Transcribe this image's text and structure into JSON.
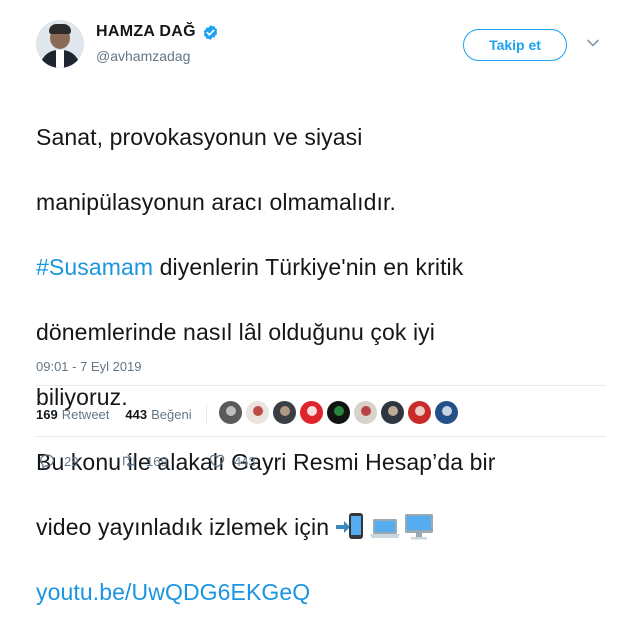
{
  "tweet": {
    "author_name": "HAMZA DAĞ",
    "author_handle": "@avhamzadag",
    "follow_label": "Takip et",
    "lines": [
      "Sanat, provokasyonun ve siyasi",
      "manipülasyonun aracı olmamalıdır."
    ],
    "hashtag": "#Susamam",
    "line3_rest": " diyenlerin Türkiye'nin en kritik",
    "line4": "dönemlerinde nasıl lâl olduğunu çok iyi",
    "line5": "biliyoruz.",
    "line6": "Bu konu ile alakalı Gayri Resmi Hesap’da bir",
    "line7": "video yayınladık izlemek için",
    "link": "youtu.be/UwQDG6EKGeQ",
    "timestamp": "09:01 - 7 Eyl 2019"
  },
  "stats": {
    "retweets": "169",
    "retweets_label": "Retweet",
    "likes": "443",
    "likes_label": "Beğeni"
  },
  "actions": {
    "replies": "29",
    "retweets": "169",
    "likes": "443"
  },
  "likers": [
    {
      "icon": "avatar-1",
      "bg": "#5a5a5a",
      "fg": "#d0d0d0"
    },
    {
      "icon": "avatar-2",
      "bg": "#e9e4e0",
      "fg": "#b5302a"
    },
    {
      "icon": "avatar-3",
      "bg": "#3a3f46",
      "fg": "#c9a98f"
    },
    {
      "icon": "avatar-4",
      "bg": "#e0242c",
      "fg": "#ffffff"
    },
    {
      "icon": "avatar-5",
      "bg": "#111511",
      "fg": "#2f9a48"
    },
    {
      "icon": "avatar-6",
      "bg": "#d8d2cc",
      "fg": "#b12c2c"
    },
    {
      "icon": "avatar-7",
      "bg": "#2f3640",
      "fg": "#dcc0a6"
    },
    {
      "icon": "avatar-8",
      "bg": "#c92b2b",
      "fg": "#f1e6df"
    },
    {
      "icon": "avatar-9",
      "bg": "#24508a",
      "fg": "#e4e9f2"
    }
  ],
  "colors": {
    "accent": "#1da1f2",
    "link": "#1b95e0",
    "muted": "#657786"
  }
}
